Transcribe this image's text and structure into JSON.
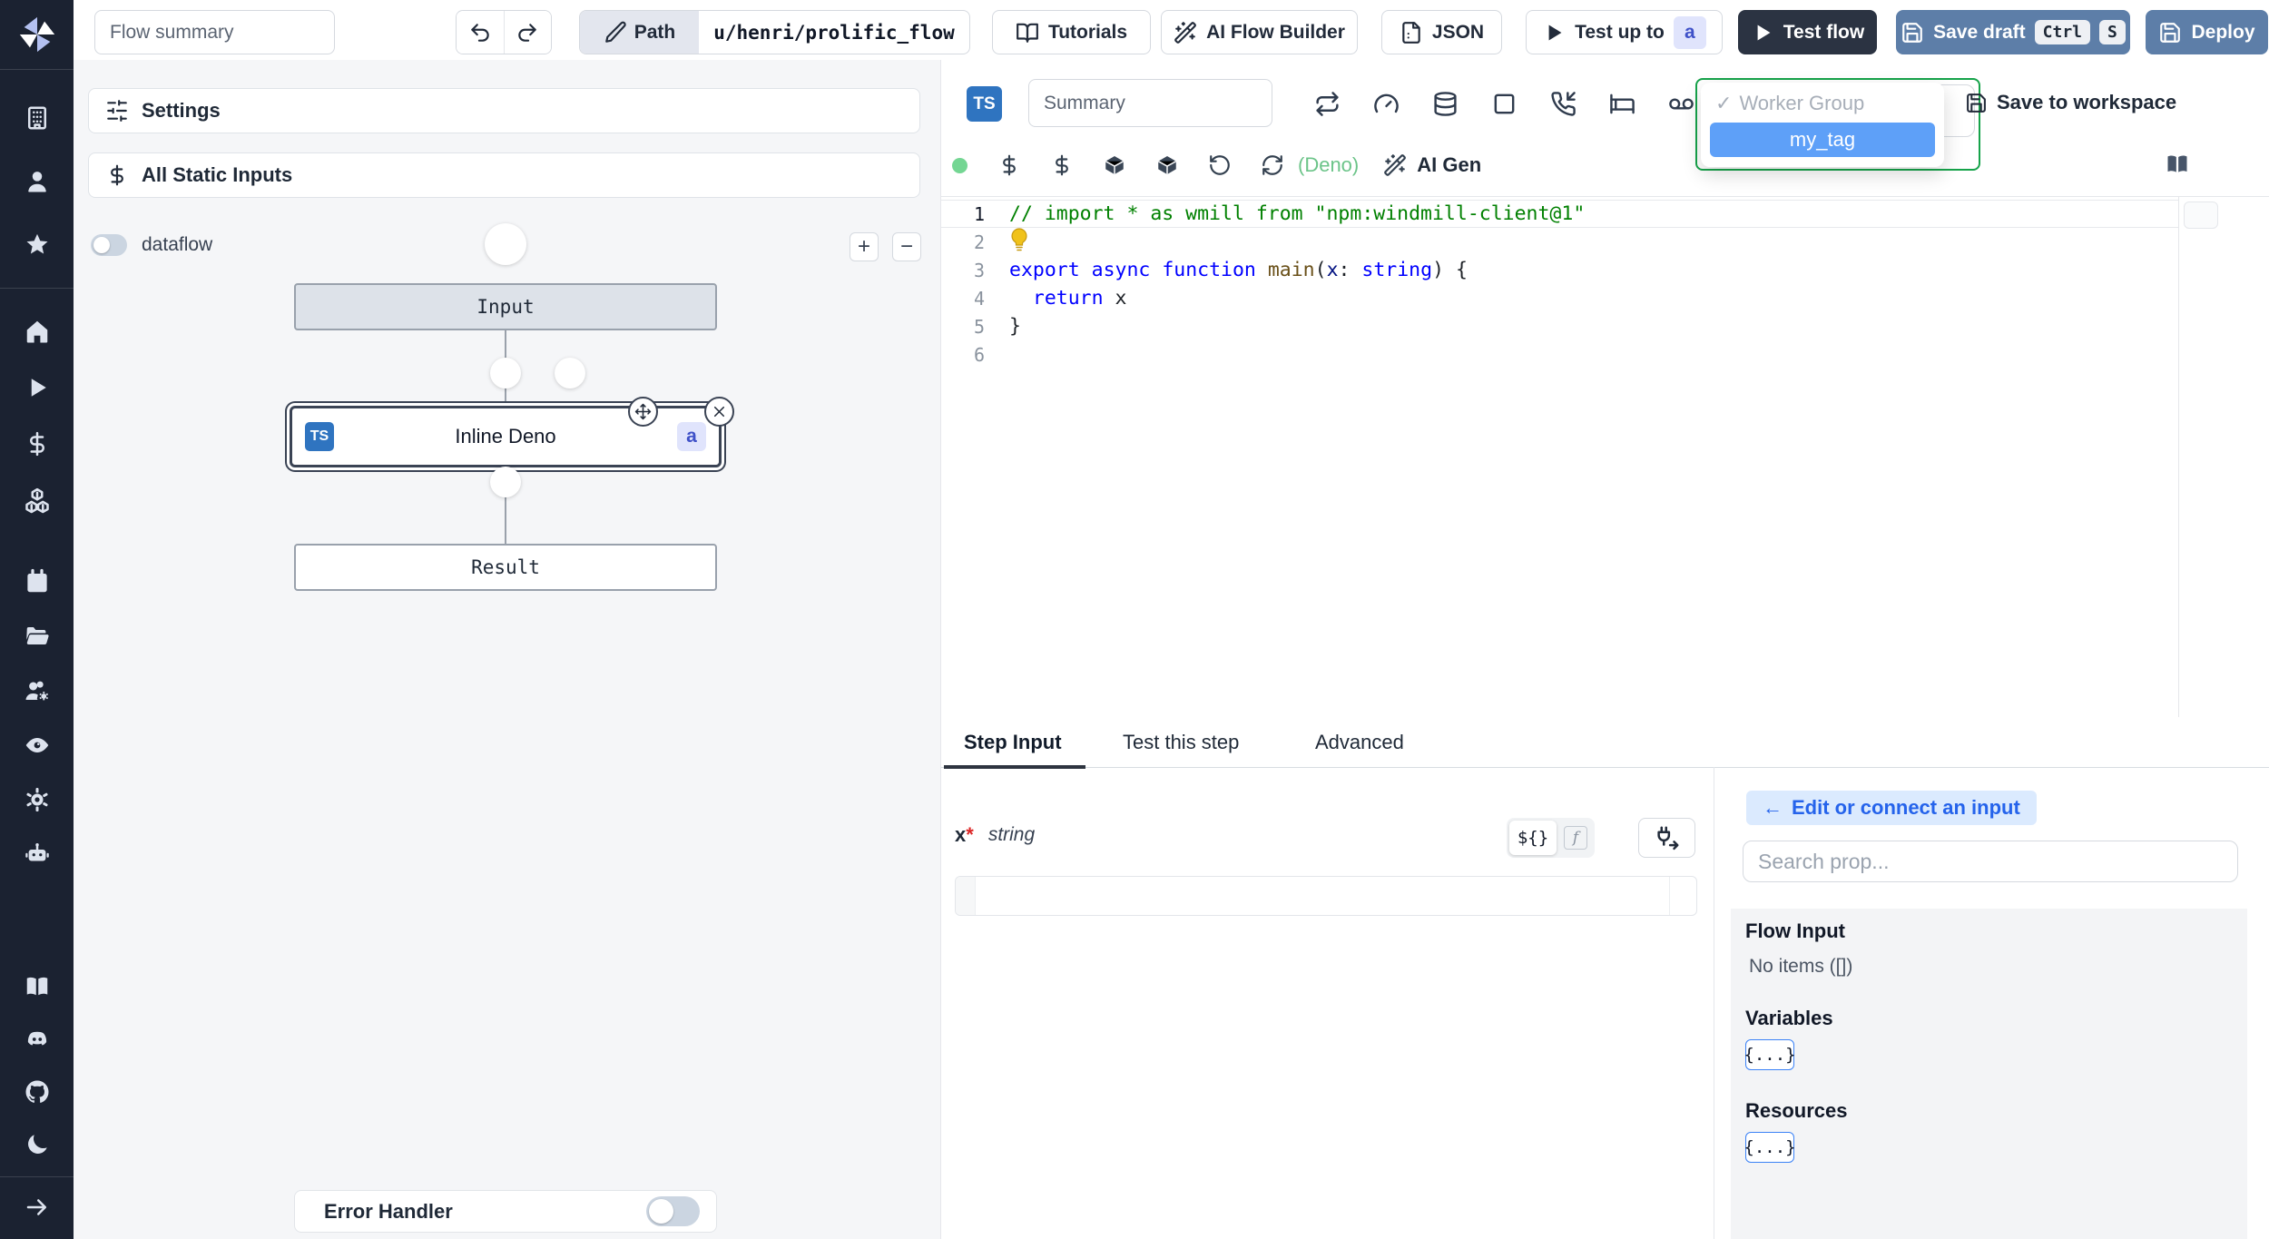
{
  "topbar": {
    "flow_summary_placeholder": "Flow summary",
    "path_label": "Path",
    "path_value": "u/henri/prolific_flow",
    "tutorials_label": "Tutorials",
    "ai_flow_builder_label": "AI Flow Builder",
    "json_label": "JSON",
    "test_up_to_label": "Test up to",
    "test_up_to_badge": "a",
    "test_flow_label": "Test flow",
    "save_draft_label": "Save draft",
    "save_draft_kbd": [
      "Ctrl",
      "S"
    ],
    "deploy_label": "Deploy"
  },
  "sidebar": {
    "workspace_icons": [
      "building",
      "user",
      "star"
    ],
    "main_icons": [
      "home",
      "play",
      "dollar",
      "boxes"
    ],
    "ops_icons": [
      "calendar",
      "folder-open",
      "user-cog",
      "eye",
      "settings",
      "bot"
    ],
    "help_icons": [
      "book",
      "discord",
      "github",
      "moon"
    ],
    "footer_icons": [
      "arrow-right"
    ]
  },
  "flow_panel": {
    "settings_label": "Settings",
    "all_static_inputs_label": "All Static Inputs",
    "dataflow_label": "dataflow",
    "zoom_in_label": "+",
    "zoom_out_label": "−",
    "nodes": {
      "input_label": "Input",
      "step_lang_badge": "TS",
      "step_label": "Inline Deno",
      "step_badge": "a",
      "result_label": "Result"
    },
    "error_handler_label": "Error Handler"
  },
  "editor": {
    "lang_badge": "TS",
    "summary_placeholder": "Summary",
    "toolbar_icons": [
      "repeat",
      "gauge",
      "database",
      "square",
      "phone-incoming",
      "bed",
      "voicemail"
    ],
    "quick_icons": [
      "dollar",
      "dollar",
      "box",
      "box",
      "rotate-ccw",
      "refresh-cw"
    ],
    "worker_group": {
      "check": "✓",
      "header": "Worker Group",
      "selected": "my_tag"
    },
    "save_to_workspace_label": "Save to workspace",
    "deno_hint": "(Deno)",
    "ai_gen_label": "AI Gen",
    "code": {
      "lines": [
        {
          "n": "1",
          "current": true,
          "tokens": [
            {
              "t": "// import * as wmill from \"npm:windmill-client@1\"",
              "c": "comment"
            }
          ]
        },
        {
          "n": "2",
          "bulb": true,
          "tokens": []
        },
        {
          "n": "3",
          "tokens": [
            {
              "t": "export",
              "c": "kw"
            },
            {
              "t": " ",
              "c": "plain"
            },
            {
              "t": "async",
              "c": "kw"
            },
            {
              "t": " ",
              "c": "plain"
            },
            {
              "t": "function",
              "c": "kw"
            },
            {
              "t": " ",
              "c": "plain"
            },
            {
              "t": "main",
              "c": "fn"
            },
            {
              "t": "(",
              "c": "plain"
            },
            {
              "t": "x",
              "c": "param"
            },
            {
              "t": ": ",
              "c": "plain"
            },
            {
              "t": "string",
              "c": "kw"
            },
            {
              "t": ") {",
              "c": "plain"
            }
          ]
        },
        {
          "n": "4",
          "tokens": [
            {
              "t": "  ",
              "c": "plain"
            },
            {
              "t": "return",
              "c": "kw"
            },
            {
              "t": " x",
              "c": "plain"
            }
          ]
        },
        {
          "n": "5",
          "tokens": [
            {
              "t": "}",
              "c": "plain"
            }
          ]
        },
        {
          "n": "6",
          "tokens": []
        }
      ]
    }
  },
  "bottom_panel": {
    "tabs": [
      {
        "label": "Step Input",
        "active": true
      },
      {
        "label": "Test this step",
        "active": false
      },
      {
        "label": "Advanced",
        "active": false
      }
    ],
    "field": {
      "name": "x",
      "required_marker": "*",
      "type": "string",
      "expr_toggle": "${}",
      "fn_toggle": "f",
      "value": ""
    },
    "picker": {
      "edit_connect_arrow": "←",
      "edit_connect_label": "Edit or connect an input",
      "search_placeholder": "Search prop...",
      "flow_input_title": "Flow Input",
      "flow_input_empty": "No items ([])",
      "variables_title": "Variables",
      "variables_chip": "{...}",
      "resources_title": "Resources",
      "resources_chip": "{...}"
    }
  },
  "colors": {
    "sidebar_bg": "#1b2231",
    "dark_button": "#2b3342",
    "slate_button": "#5d7ea8",
    "badge_bg": "#e0e4fc",
    "badge_text": "#3f51c8",
    "dropdown_border_green": "#16a34a",
    "selected_tag_bg": "#5ea0f8",
    "accent_blue": "#3b82f6",
    "lang_dot_green": "#74d693",
    "ts_badge_blue": "#2f74c0"
  }
}
